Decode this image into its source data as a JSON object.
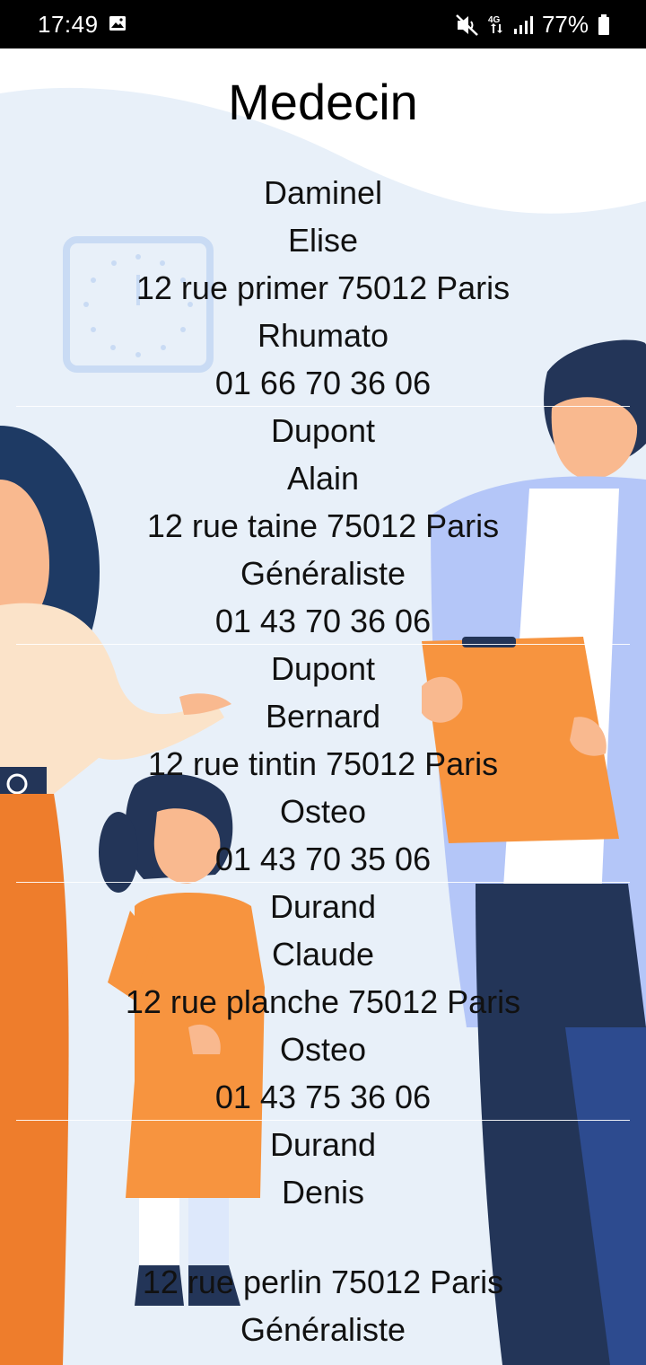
{
  "status_bar": {
    "time": "17:49",
    "battery": "77%",
    "icons": [
      "gallery-icon",
      "mute-icon",
      "4g-network-icon",
      "signal-icon",
      "battery-icon"
    ]
  },
  "page": {
    "title": "Medecin"
  },
  "doctors": [
    {
      "last_name": "Daminel",
      "first_name": "Elise",
      "address": "12 rue primer 75012 Paris",
      "specialty": "Rhumato",
      "phone": "01 66 70 36 06"
    },
    {
      "last_name": "Dupont",
      "first_name": "Alain",
      "address": "12 rue taine 75012 Paris",
      "specialty": "Généraliste",
      "phone": "01 43 70 36 06"
    },
    {
      "last_name": "Dupont",
      "first_name": "Bernard",
      "address": "12 rue tintin 75012 Paris",
      "specialty": "Osteo",
      "phone": "01 43 70 35 06"
    },
    {
      "last_name": "Durand",
      "first_name": "Claude",
      "address": "12 rue planche 75012 Paris",
      "specialty": "Osteo",
      "phone": "01 43 75 36 06"
    },
    {
      "last_name": "Durand",
      "first_name": "Denis",
      "address": "12 rue perlin 75012 Paris",
      "specialty": "Généraliste",
      "phone": ""
    }
  ],
  "colors": {
    "status_bar_bg": "#000000",
    "background_wave": "#e8f0f9",
    "orange": "#f7943f",
    "dark_orange": "#ee7d2c",
    "navy": "#233558",
    "lab_coat": "#b4c6f8",
    "skin": "#f9b98f"
  }
}
